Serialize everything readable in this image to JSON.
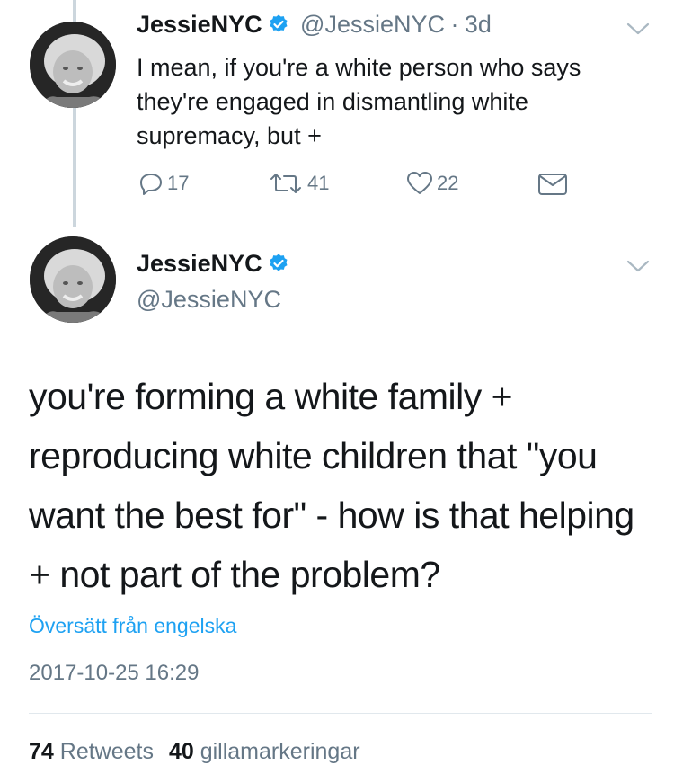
{
  "tweet1": {
    "name": "JessieNYC",
    "handle": "@JessieNYC",
    "sep": "·",
    "age": "3d",
    "text": "I mean, if you're a white person who says they're engaged in dismantling white supremacy, but +",
    "replies": "17",
    "retweets": "41",
    "likes": "22",
    "icons": [
      "reply-icon",
      "retweet-icon",
      "heart-icon",
      "envelope-icon",
      "verified-icon",
      "chevron-down-icon"
    ]
  },
  "tweet2": {
    "name": "JessieNYC",
    "handle": "@JessieNYC",
    "text": "you're forming a white family + reproducing white children that \"you want the best for\" - how is that helping + not part of the problem?",
    "translate": "Översätt från engelska",
    "timestamp": "2017-10-25 16:29",
    "retweets_count": "74",
    "retweets_label": "Retweets",
    "likes_count": "40",
    "likes_label": "gillamarkeringar"
  },
  "colors": {
    "accent": "#1da1f2",
    "secondary_text": "#657786",
    "primary_text": "#14171a",
    "thread_line": "#ccd6dd"
  }
}
